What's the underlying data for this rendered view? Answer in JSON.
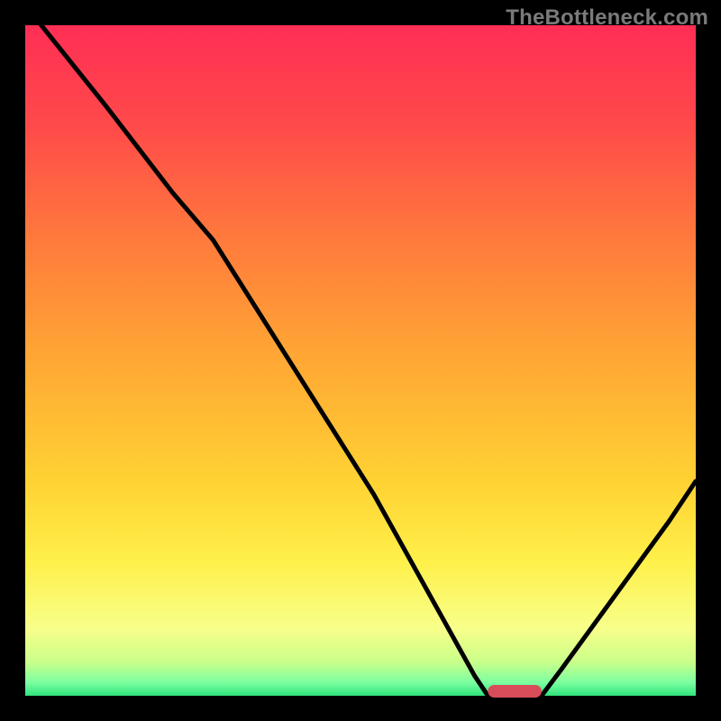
{
  "watermark": {
    "text": "TheBottleneck.com"
  },
  "colors": {
    "frame_black": "#000000",
    "curve_black": "#000000",
    "marker_red": "#d94c5a",
    "gradient_stops": [
      {
        "offset": 0.0,
        "color": "#ff2e55"
      },
      {
        "offset": 0.15,
        "color": "#ff4a4a"
      },
      {
        "offset": 0.32,
        "color": "#ff7a3c"
      },
      {
        "offset": 0.5,
        "color": "#ffa834"
      },
      {
        "offset": 0.68,
        "color": "#ffd233"
      },
      {
        "offset": 0.8,
        "color": "#fff04a"
      },
      {
        "offset": 0.9,
        "color": "#f7ff8a"
      },
      {
        "offset": 0.95,
        "color": "#c9ff8a"
      },
      {
        "offset": 0.98,
        "color": "#7dffa0"
      },
      {
        "offset": 1.0,
        "color": "#2fe37c"
      }
    ]
  },
  "chart_data": {
    "type": "line",
    "title": "",
    "xlabel": "",
    "ylabel": "",
    "xlim": [
      0,
      100
    ],
    "ylim": [
      0,
      100
    ],
    "grid": false,
    "annotations": [
      "TheBottleneck.com"
    ],
    "marker": {
      "x_range": [
        69,
        77
      ],
      "y": 0
    },
    "curve_points": [
      {
        "x": 0,
        "y": 103
      },
      {
        "x": 12,
        "y": 88
      },
      {
        "x": 22,
        "y": 75
      },
      {
        "x": 28,
        "y": 68
      },
      {
        "x": 40,
        "y": 49
      },
      {
        "x": 52,
        "y": 30
      },
      {
        "x": 62,
        "y": 12
      },
      {
        "x": 67,
        "y": 3
      },
      {
        "x": 69,
        "y": 0
      },
      {
        "x": 77,
        "y": 0
      },
      {
        "x": 80,
        "y": 4
      },
      {
        "x": 88,
        "y": 15
      },
      {
        "x": 96,
        "y": 26
      },
      {
        "x": 100,
        "y": 32
      }
    ]
  }
}
